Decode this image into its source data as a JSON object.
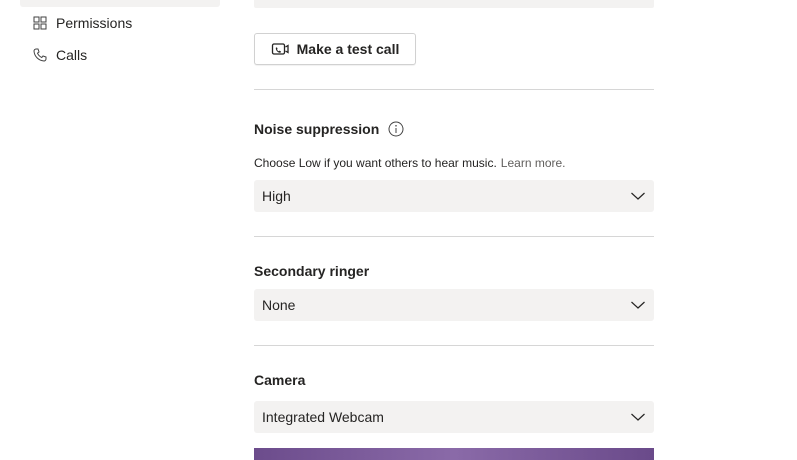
{
  "sidebar": {
    "items": [
      {
        "label": "Permissions",
        "icon": "permissions-icon"
      },
      {
        "label": "Calls",
        "icon": "phone-icon"
      }
    ]
  },
  "devices": {
    "test_call_label": "Make a test call",
    "noise_suppression": {
      "title": "Noise suppression",
      "description": "Choose Low if you want others to hear music.",
      "learn_more": "Learn more.",
      "value": "High"
    },
    "secondary_ringer": {
      "title": "Secondary ringer",
      "value": "None"
    },
    "camera": {
      "title": "Camera",
      "value": "Integrated Webcam"
    }
  },
  "colors": {
    "select_bg": "#f3f2f1",
    "divider": "#d6d6d6",
    "text": "#252423",
    "link": "#605e5c",
    "camera_preview": "#7a5a9a"
  }
}
